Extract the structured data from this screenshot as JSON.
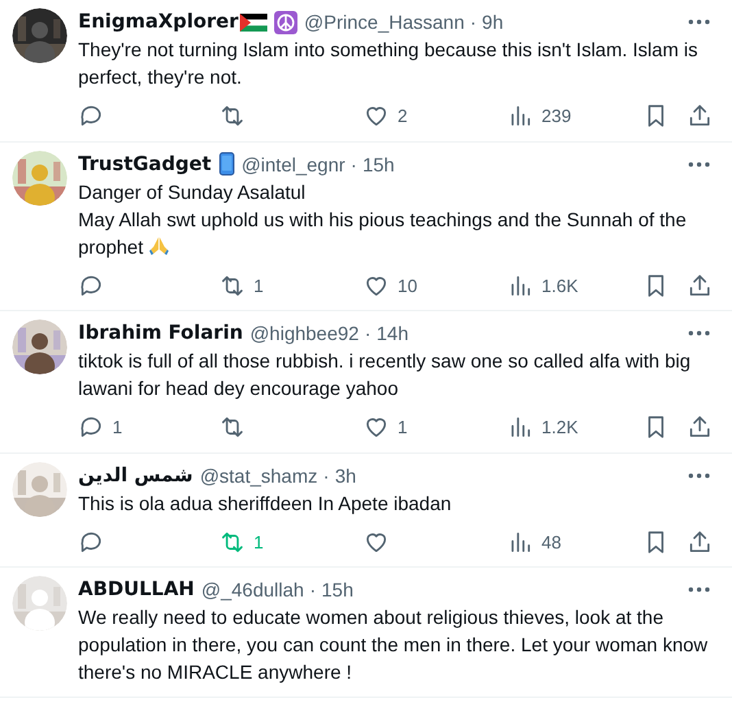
{
  "tweets": [
    {
      "name": "EnigmaXplorer",
      "badges": [
        {
          "kind": "flag"
        },
        {
          "kind": "peace"
        }
      ],
      "handle": "@Prince_Hassann",
      "separator": "·",
      "time": "9h",
      "lines": [
        "They're not turning Islam into something because this isn't Islam. Islam is perfect, they're not."
      ],
      "actions": {
        "likes": "2",
        "views": "239",
        "reposted": false
      }
    },
    {
      "name": "TrustGadget",
      "badges": [
        {
          "kind": "phone"
        }
      ],
      "handle": "@intel_egnr",
      "separator": "·",
      "time": "15h",
      "lines": [
        "Danger of Sunday Asalatul",
        "May Allah swt uphold us with his pious teachings and the Sunnah of the prophet"
      ],
      "trailing": {
        "kind": "pray"
      },
      "actions": {
        "reposts": "1",
        "likes": "10",
        "views": "1.6K",
        "reposted": false
      }
    },
    {
      "name": "Ibrahim Folarin",
      "handle": "@highbee92",
      "separator": "·",
      "time": "14h",
      "lines": [
        "tiktok is full of all those rubbish. i recently saw one so called alfa with big lawani for head dey encourage yahoo"
      ],
      "actions": {
        "replies": "1",
        "likes": "1",
        "views": "1.2K",
        "reposted": false
      }
    },
    {
      "name": "شمس الدين",
      "handle": "@stat_shamz",
      "separator": "·",
      "time": "3h",
      "lines": [
        "This is ola adua sheriffdeen  In Apete ibadan"
      ],
      "actions": {
        "reposts": "1",
        "views": "48",
        "reposted": true
      }
    },
    {
      "name": "ABDULLAH",
      "handle": "@_46dullah",
      "separator": "·",
      "time": "15h",
      "lines": [
        "We really need to educate women about religious thieves, look at the population in there, you can count the men in there. Let your woman know there's no MIRACLE anywhere !"
      ]
    }
  ]
}
